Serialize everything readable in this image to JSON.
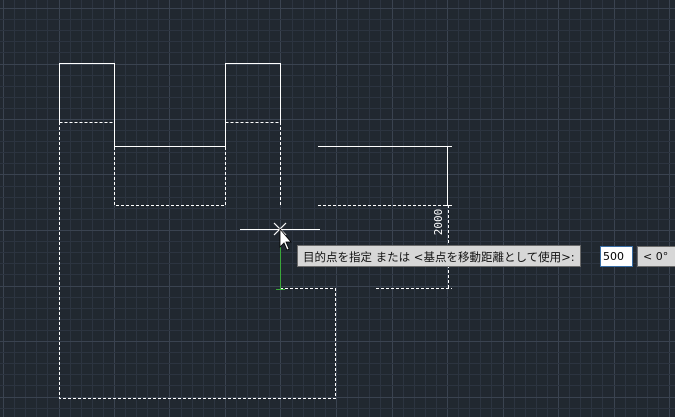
{
  "canvas": {
    "background": "#212830",
    "minor_grid_color": "#2c3440",
    "major_grid_color": "#3a4350"
  },
  "dynamic_input": {
    "prompt": "目的点を指定 または <基点を移動距離として使用>:",
    "distance_value": "500",
    "angle_value": "< 0°"
  },
  "dimension": {
    "text": "2000"
  },
  "cursor": {
    "icon": "crosshair-arrow-icon"
  },
  "colors": {
    "geometry": "#ffffff",
    "preview": "#ffffff",
    "ucs_green": "#3aa83a"
  }
}
